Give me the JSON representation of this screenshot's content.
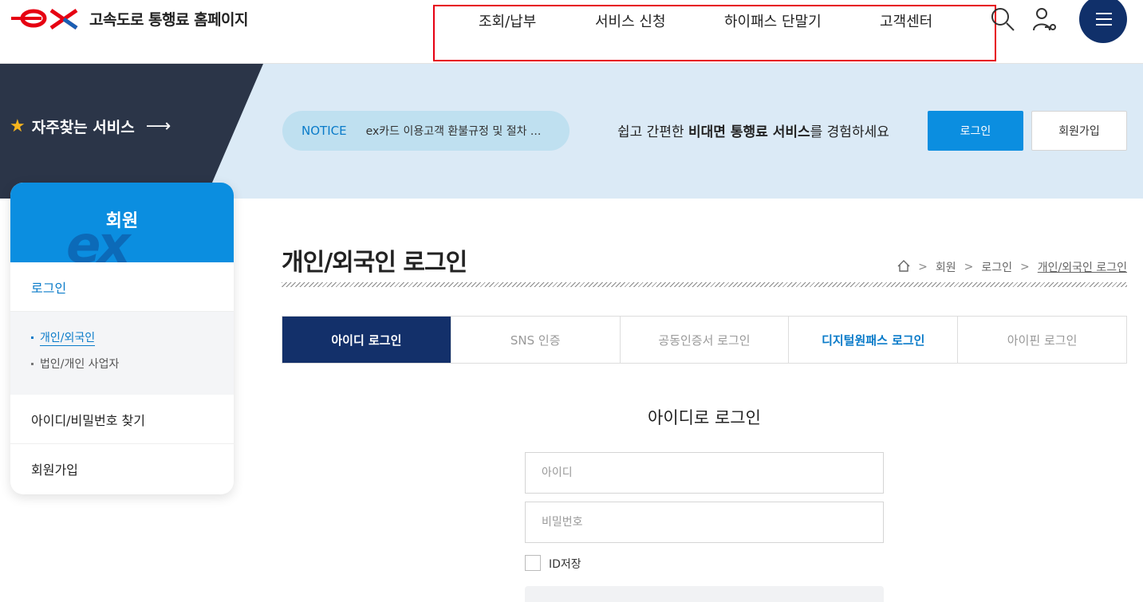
{
  "header": {
    "logo_text": "고속도로 통행료 홈페이지",
    "nav": [
      "조회/납부",
      "서비스 신청",
      "하이패스 단말기",
      "고객센터"
    ]
  },
  "banner": {
    "favorites": "자주찾는 서비스",
    "notice_label": "NOTICE",
    "notice_text": "ex카드 이용고객 환불규정 및 절차 ...",
    "slogan_pre": "쉽고 간편한 ",
    "slogan_bold": "비대면 통행료 서비스",
    "slogan_post": "를 경험하세요",
    "login_button": "로그인",
    "join_button": "회원가입"
  },
  "sidebar": {
    "title": "회원",
    "watermark": "ex",
    "login": "로그인",
    "sub_items": [
      "개인/외국인",
      "법인/개인 사업자"
    ],
    "find": "아이디/비밀번호 찾기",
    "join": "회원가입"
  },
  "content": {
    "title": "개인/외국인 로그인",
    "breadcrumb": [
      "회원",
      "로그인",
      "개인/외국인 로그인"
    ],
    "tabs": [
      "아이디 로그인",
      "SNS 인증",
      "공동인증서 로그인",
      "디지털원패스 로그인",
      "아이핀 로그인"
    ],
    "form_title": "아이디로 로그인",
    "id_placeholder": "아이디",
    "pw_placeholder": "비밀번호",
    "save_id": "ID저장"
  },
  "colors": {
    "primary": "#0b8ee0",
    "navy": "#13306a",
    "highlight_box": "#e60012"
  }
}
